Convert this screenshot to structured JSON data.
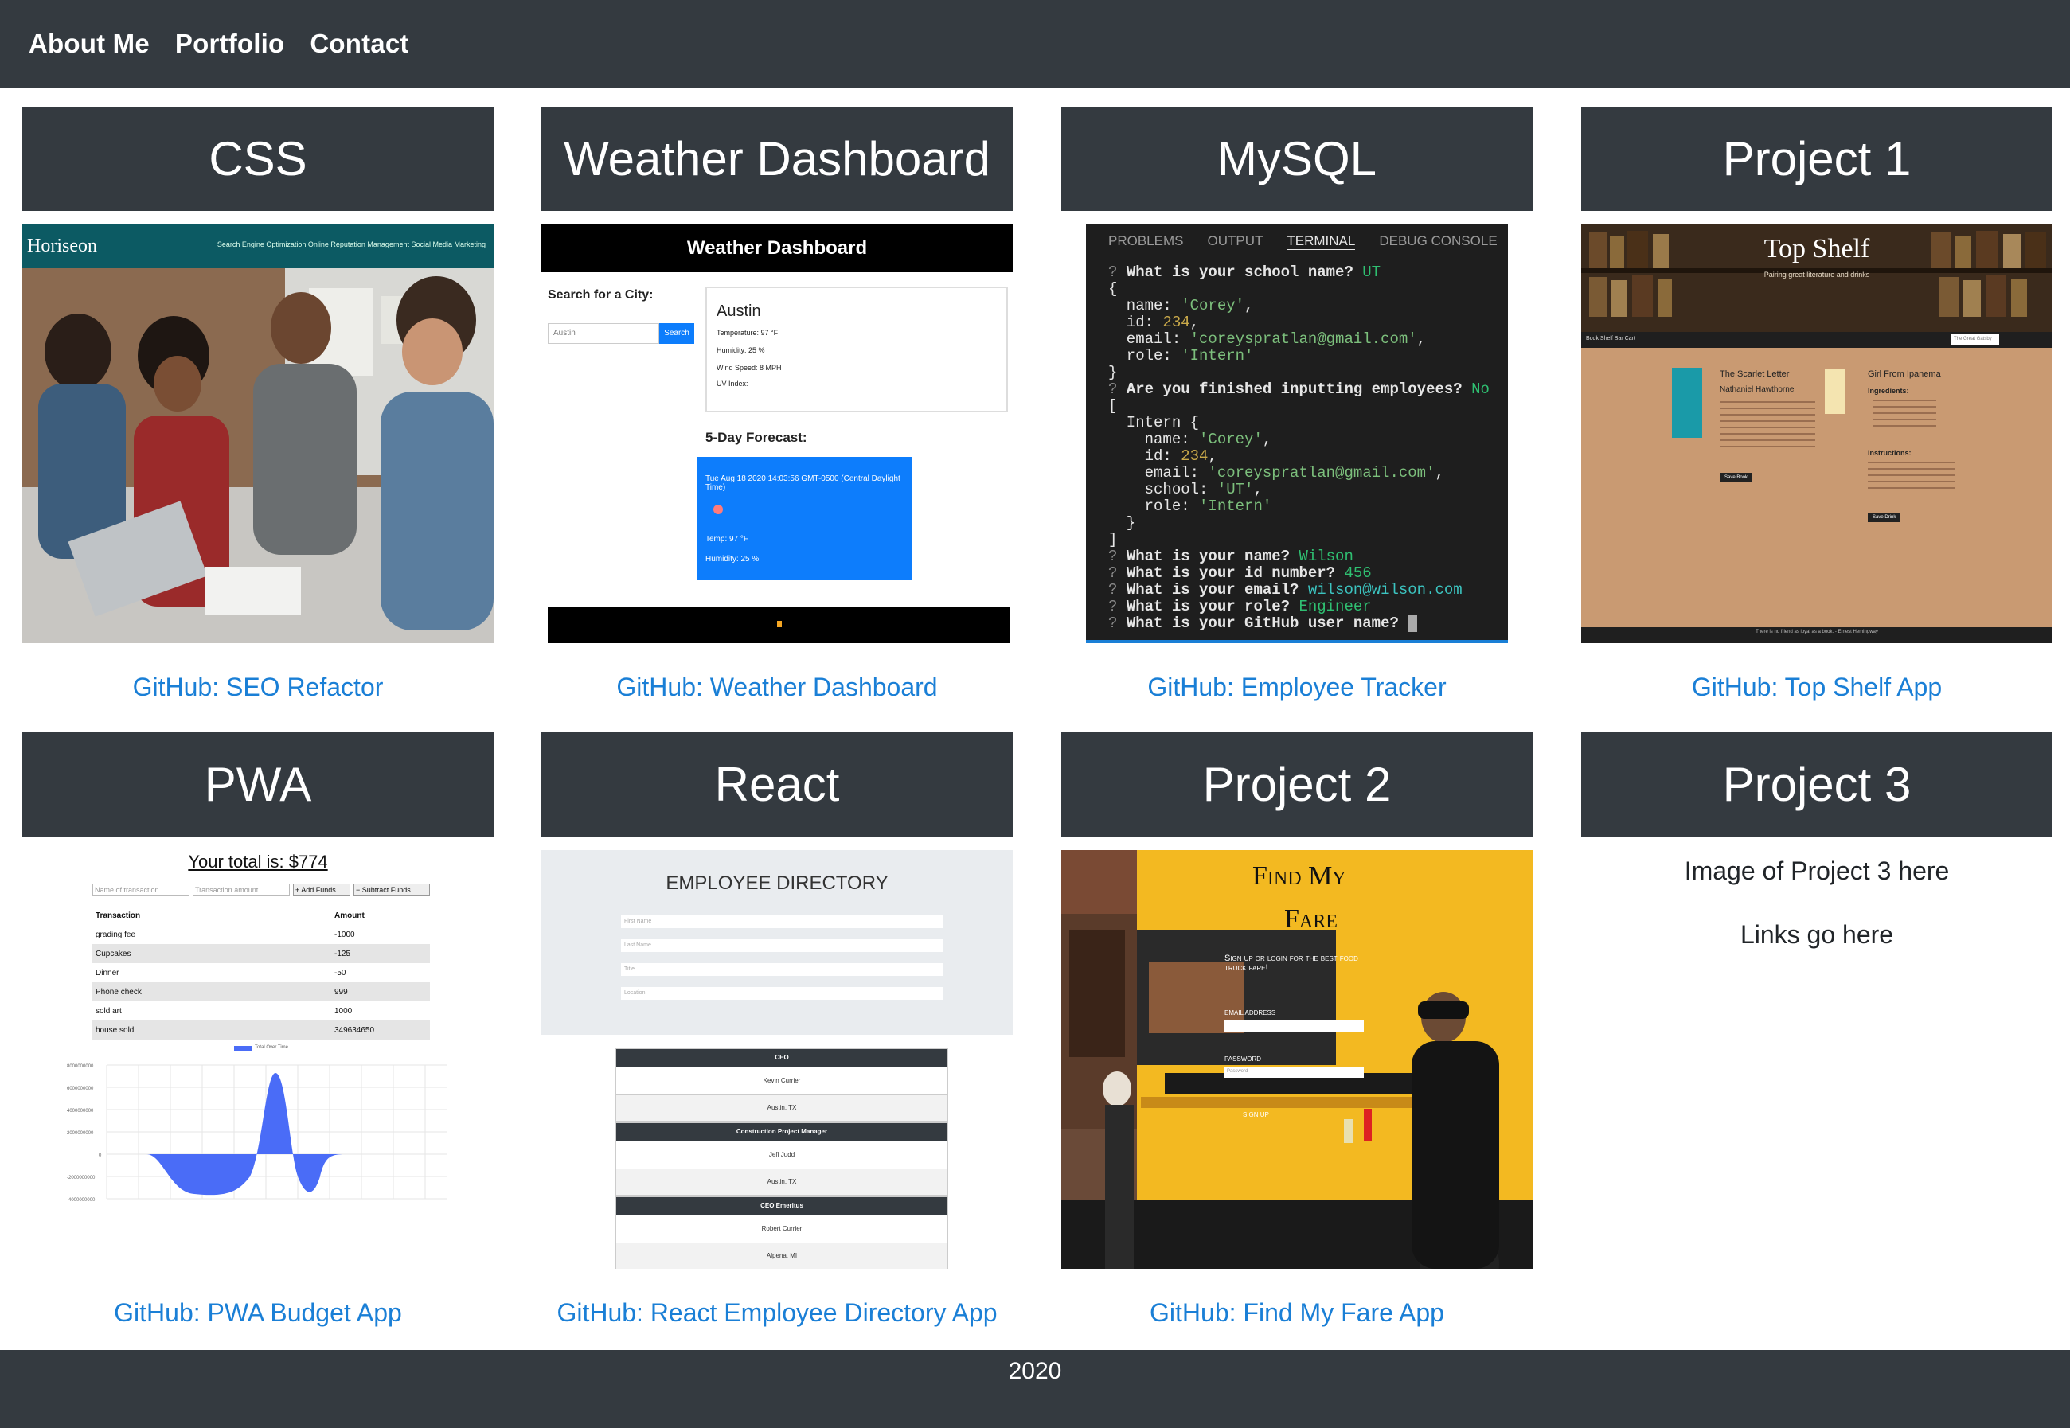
{
  "nav": {
    "items": [
      "About Me",
      "Portfolio",
      "Contact"
    ]
  },
  "cards": [
    {
      "title": "CSS",
      "link": "GitHub: SEO Refactor",
      "image": "screenshot of Horiseon SEO site"
    },
    {
      "title": "Weather Dashboard",
      "link": "GitHub: Weather Dashboard",
      "image": "screenshot of weather dashboard app"
    },
    {
      "title": "MySQL",
      "link": "GitHub: Employee Tracker",
      "image": "screenshot of terminal employee tracker"
    },
    {
      "title": "Project 1",
      "link": "GitHub: Top Shelf App",
      "image": "screenshot of Top Shelf app"
    },
    {
      "title": "PWA",
      "link": "GitHub: PWA Budget App",
      "image": "screenshot of PWA budget app"
    },
    {
      "title": "React",
      "link": "GitHub: React Employee Directory App",
      "image": "screenshot of employee directory app"
    },
    {
      "title": "Project 2",
      "link": "GitHub: Find My Fare App",
      "image": "photo of food truck Find My Fare"
    },
    {
      "title": "Project 3",
      "link": "",
      "image": ""
    }
  ],
  "project3": {
    "image_placeholder": "Image of Project 3 here",
    "links_placeholder": "Links go here"
  },
  "screens": {
    "css": {
      "brand": "Horiseon",
      "nav": "Search Engine Optimization   Online Reputation Management   Social Media Marketing"
    },
    "weather": {
      "header": "Weather Dashboard",
      "search_label": "Search for a City:",
      "search_value": "Austin",
      "search_button": "Search",
      "city": "Austin",
      "temperature": "Temperature: 97 °F",
      "humidity": "Humidity: 25 %",
      "wind": "Wind Speed: 8 MPH",
      "uv": "UV Index:",
      "forecast_title": "5-Day Forecast:",
      "forecast_date": "Tue Aug 18 2020 14:03:56 GMT-0500 (Central Daylight Time)",
      "forecast_temp": "Temp: 97 °F",
      "forecast_humidity": "Humidity: 25 %"
    },
    "mysql": {
      "tabs": [
        "PROBLEMS",
        "OUTPUT",
        "TERMINAL",
        "DEBUG CONSOLE"
      ],
      "active_tab": "TERMINAL"
    },
    "shelf": {
      "title": "Top Shelf",
      "subtitle": "Pairing great literature and drinks",
      "book_title": "The Scarlet Letter",
      "book_author": "Nathaniel Hawthorne",
      "drink_title": "Girl From Ipanema",
      "ingredients": "Ingredients:",
      "instructions": "Instructions:",
      "button_book": "Save Book",
      "button_drink": "Save Drink",
      "nav_left": "Book Shelf   Bar Cart",
      "search_value": "The Great Gatsby",
      "footer": "There is no friend as loyal as a book. - Ernest Hemingway"
    },
    "pwa": {
      "total": "Your total is: $774",
      "name_placeholder": "Name of transaction",
      "amount_placeholder": "Transaction amount",
      "add_button": "+ Add Funds",
      "subtract_button": "− Subtract Funds",
      "headers": [
        "Transaction",
        "Amount"
      ],
      "rows": [
        [
          "grading fee",
          "-1000"
        ],
        [
          "Cupcakes",
          "-125"
        ],
        [
          "Dinner",
          "-50"
        ],
        [
          "Phone check",
          "999"
        ],
        [
          "sold art",
          "1000"
        ],
        [
          "house sold",
          "349634650"
        ]
      ],
      "chart_legend": "Total Over Time"
    },
    "react": {
      "title": "EMPLOYEE DIRECTORY",
      "fields": [
        "First Name",
        "Last Name",
        "Title",
        "Location"
      ],
      "employees": [
        {
          "role": "CEO",
          "name": "Kevin Currier",
          "location": "Austin, TX"
        },
        {
          "role": "Construction Project Manager",
          "name": "Jeff Judd",
          "location": "Austin, TX"
        },
        {
          "role": "CEO Emeritus",
          "name": "Robert Currier",
          "location": "Alpena, MI"
        }
      ]
    },
    "fare": {
      "title_line1": "Find My",
      "title_line2": "Fare",
      "subtitle": "Sign up or login for the best food truck fare!",
      "email_label": "EMAIL ADDRESS",
      "password_label": "PASSWORD",
      "password_placeholder": "Password",
      "signup": "SIGN UP"
    }
  },
  "footer": {
    "text": "2020"
  },
  "colors": {
    "dark": "#343a40",
    "link": "#1a7fd6",
    "white": "#ffffff"
  }
}
